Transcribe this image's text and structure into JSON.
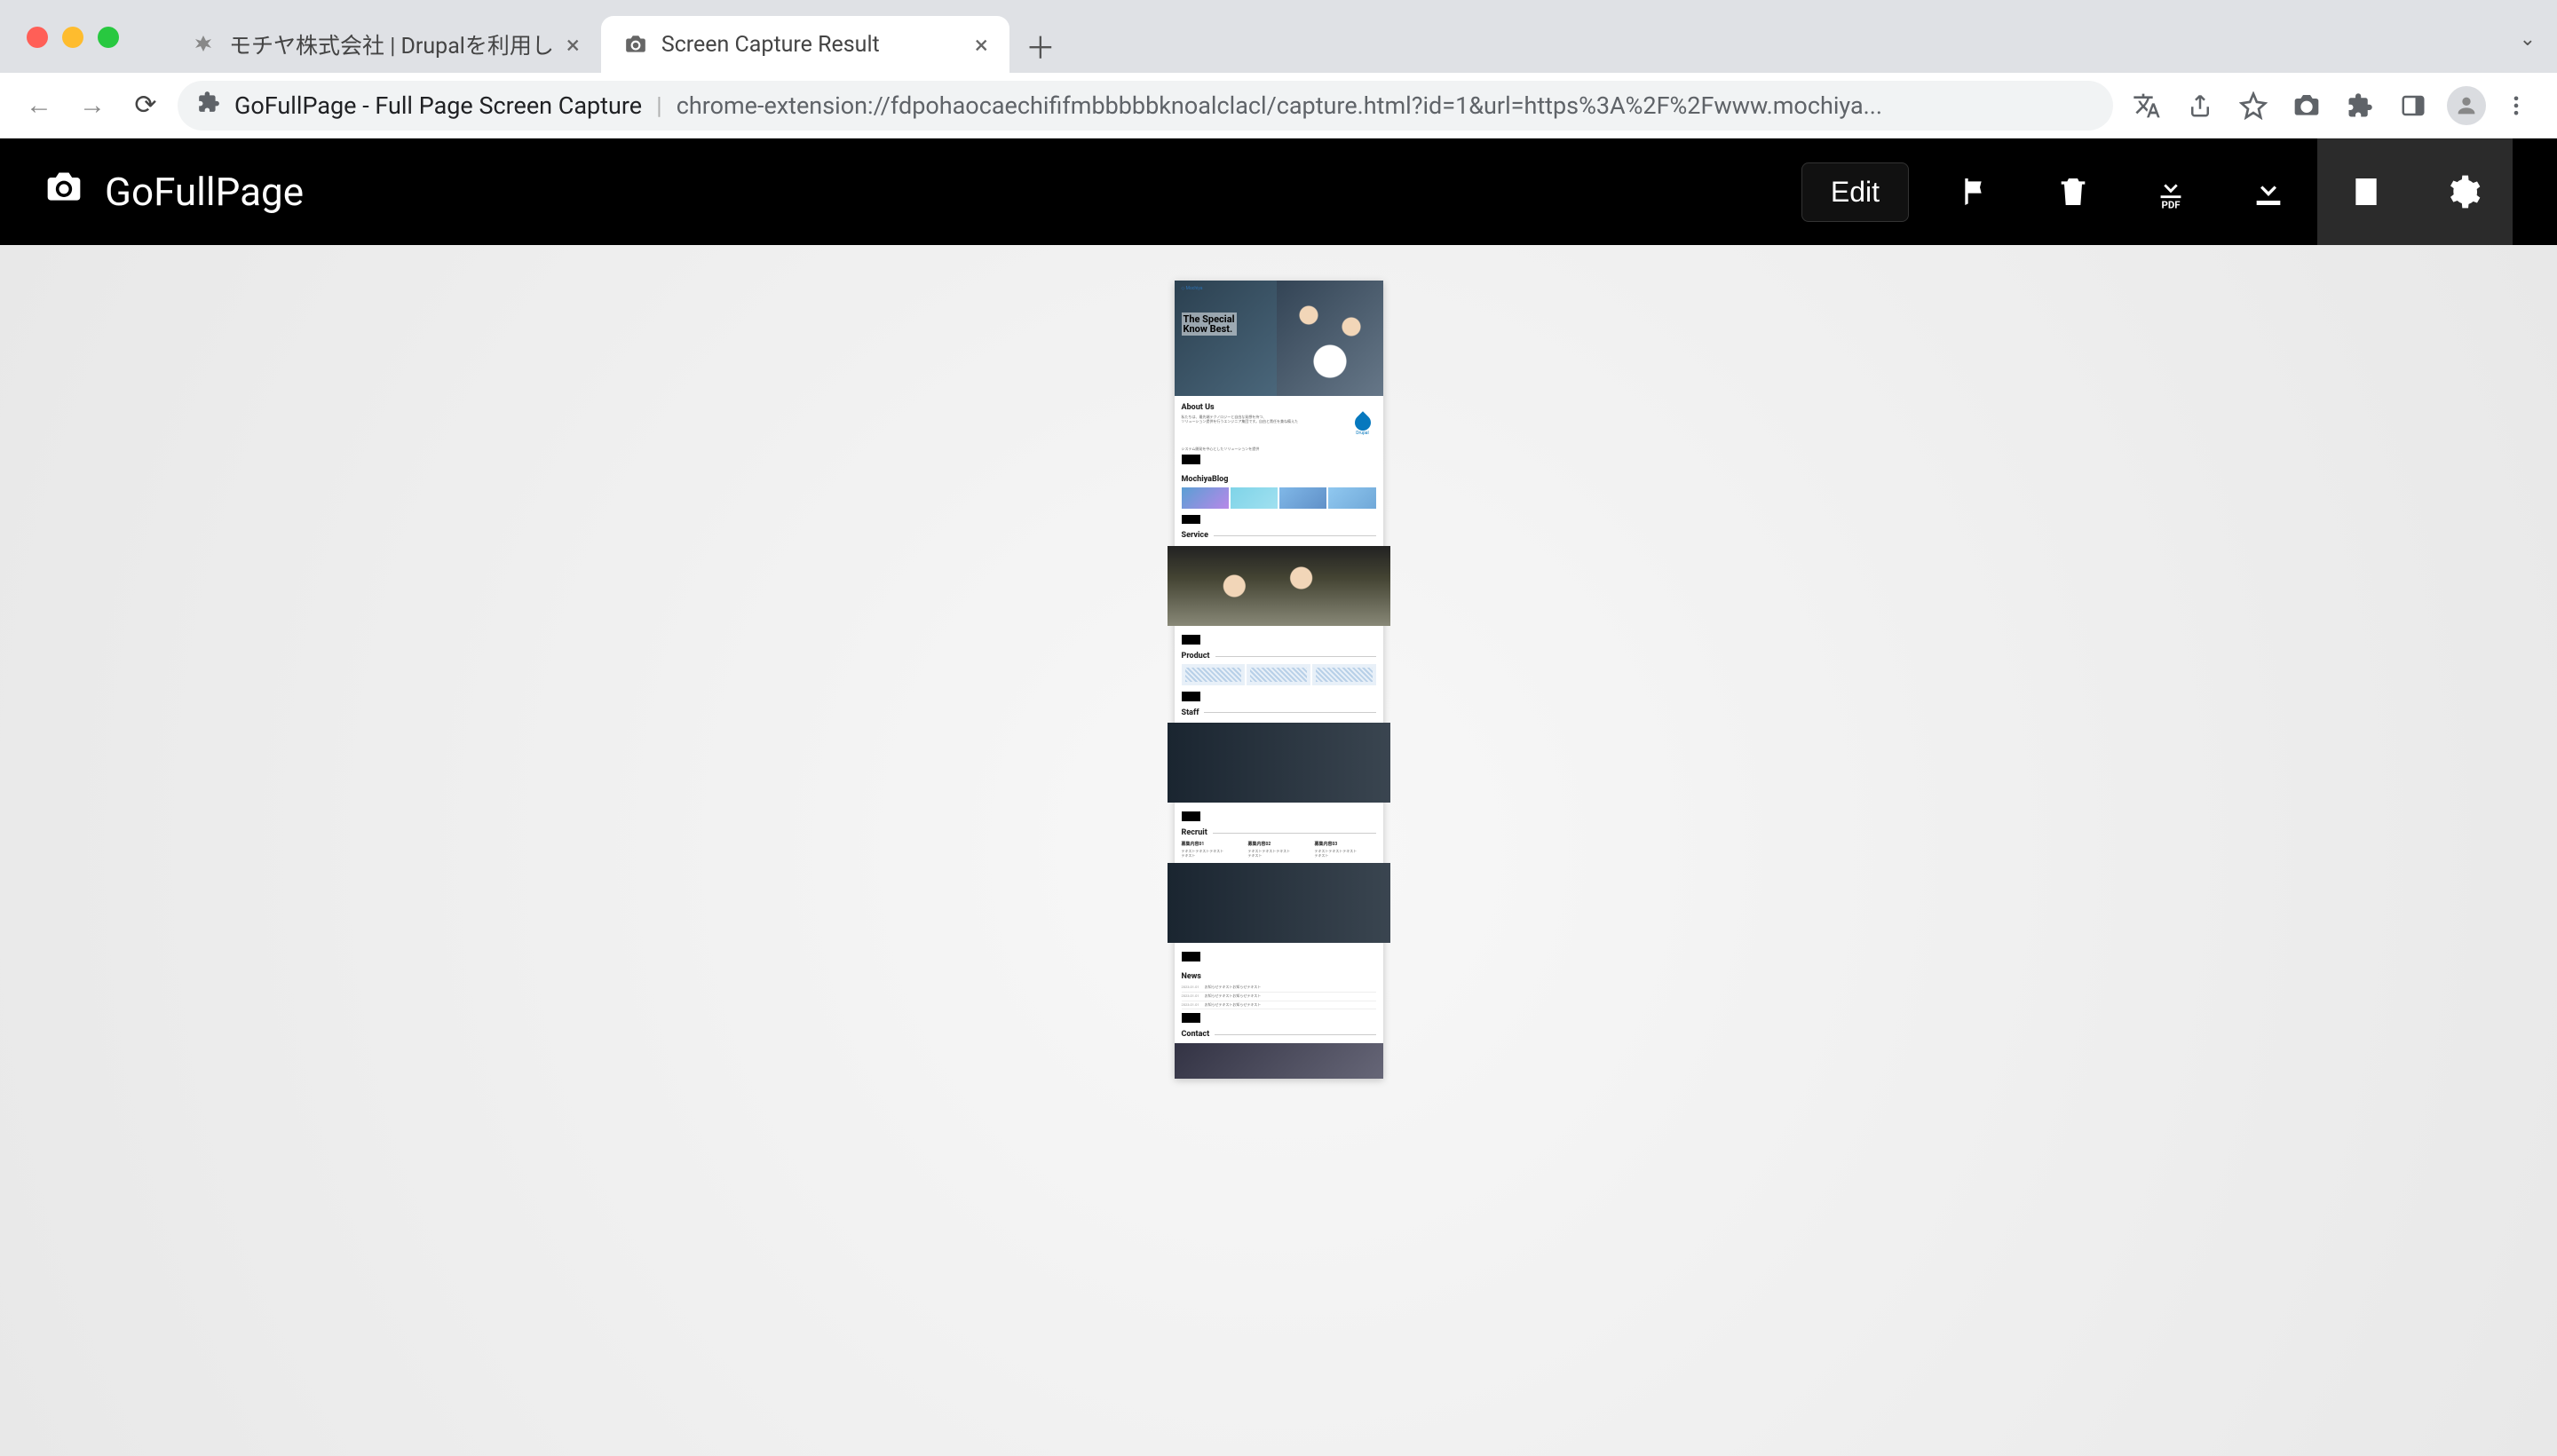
{
  "browser": {
    "tabs": [
      {
        "title": "モチヤ株式会社 | Drupalを利用し",
        "active": false
      },
      {
        "title": "Screen Capture Result",
        "active": true
      }
    ],
    "url_title": "GoFullPage - Full Page Screen Capture",
    "url_path": "chrome-extension://fdpohaocaechififmbbbbbknoalclacl/capture.html?id=1&url=https%3A%2F%2Fwww.mochiya..."
  },
  "app": {
    "name": "GoFullPage",
    "edit_label": "Edit"
  },
  "capture": {
    "site_logo": "◇ Mochiya",
    "hero_line1": "The Special",
    "hero_line2": "Know Best.",
    "sections": {
      "about": {
        "heading": "About Us",
        "note": "Drupal"
      },
      "blog": {
        "heading": "MochiyaBlog"
      },
      "service": {
        "heading": "Service"
      },
      "product": {
        "heading": "Product"
      },
      "staff": {
        "heading": "Staff"
      },
      "recruit": {
        "heading": "Recruit"
      },
      "news": {
        "heading": "News"
      },
      "contact": {
        "heading": "Contact"
      }
    }
  }
}
